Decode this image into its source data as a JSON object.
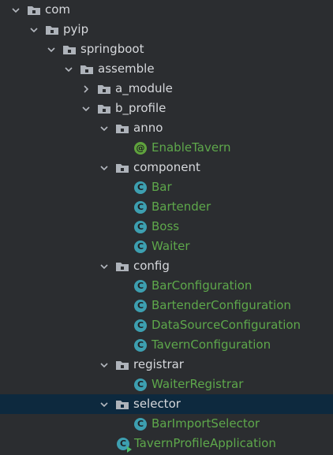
{
  "colors": {
    "background": "#2b2d30",
    "selected_row": "#0d293e",
    "package_text": "#d6d8dc",
    "class_text": "#5ea84b",
    "class_icon": "#3d9fb0",
    "annotation_icon": "#5fa23d"
  },
  "tree": {
    "nodes": [
      {
        "label": "com",
        "kind": "package",
        "expanded": true,
        "icon": "folder-package-icon"
      },
      {
        "label": "pyip",
        "kind": "package",
        "expanded": true,
        "icon": "folder-package-icon"
      },
      {
        "label": "springboot",
        "kind": "package",
        "expanded": true,
        "icon": "folder-package-icon"
      },
      {
        "label": "assemble",
        "kind": "package",
        "expanded": true,
        "icon": "folder-package-icon"
      },
      {
        "label": "a_module",
        "kind": "package",
        "expanded": false,
        "icon": "folder-package-icon"
      },
      {
        "label": "b_profile",
        "kind": "package",
        "expanded": true,
        "icon": "folder-package-icon"
      },
      {
        "label": "anno",
        "kind": "package",
        "expanded": true,
        "icon": "folder-package-icon"
      },
      {
        "label": "EnableTavern",
        "kind": "annotation",
        "icon": "annotation-icon",
        "icon_glyph": "@"
      },
      {
        "label": "component",
        "kind": "package",
        "expanded": true,
        "icon": "folder-package-icon"
      },
      {
        "label": "Bar",
        "kind": "class",
        "icon": "class-icon",
        "icon_glyph": "C"
      },
      {
        "label": "Bartender",
        "kind": "class",
        "icon": "class-icon",
        "icon_glyph": "C"
      },
      {
        "label": "Boss",
        "kind": "class",
        "icon": "class-icon",
        "icon_glyph": "C"
      },
      {
        "label": "Waiter",
        "kind": "class",
        "icon": "class-icon",
        "icon_glyph": "C"
      },
      {
        "label": "config",
        "kind": "package",
        "expanded": true,
        "icon": "folder-package-icon"
      },
      {
        "label": "BarConfiguration",
        "kind": "class",
        "icon": "class-icon",
        "icon_glyph": "C"
      },
      {
        "label": "BartenderConfiguration",
        "kind": "class",
        "icon": "class-icon",
        "icon_glyph": "C"
      },
      {
        "label": "DataSourceConfiguration",
        "kind": "class",
        "icon": "class-icon",
        "icon_glyph": "C"
      },
      {
        "label": "TavernConfiguration",
        "kind": "class",
        "icon": "class-icon",
        "icon_glyph": "C"
      },
      {
        "label": "registrar",
        "kind": "package",
        "expanded": true,
        "icon": "folder-package-icon"
      },
      {
        "label": "WaiterRegistrar",
        "kind": "class",
        "icon": "class-icon",
        "icon_glyph": "C"
      },
      {
        "label": "selector",
        "kind": "package",
        "expanded": true,
        "selected": true,
        "icon": "folder-package-icon"
      },
      {
        "label": "BarImportSelector",
        "kind": "class",
        "icon": "class-icon",
        "icon_glyph": "C"
      },
      {
        "label": "TavernProfileApplication",
        "kind": "app",
        "icon": "spring-boot-application-icon",
        "icon_glyph": "C"
      }
    ]
  }
}
